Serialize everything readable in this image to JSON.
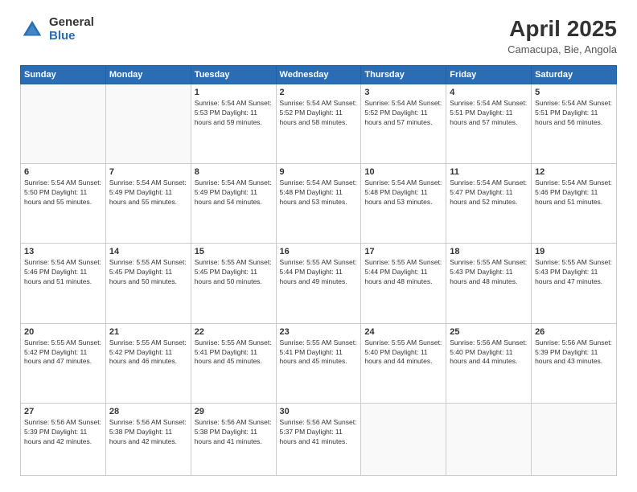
{
  "header": {
    "logo": {
      "general": "General",
      "blue": "Blue"
    },
    "title": "April 2025",
    "location": "Camacupa, Bie, Angola"
  },
  "calendar": {
    "days_of_week": [
      "Sunday",
      "Monday",
      "Tuesday",
      "Wednesday",
      "Thursday",
      "Friday",
      "Saturday"
    ],
    "weeks": [
      [
        {
          "day": "",
          "content": ""
        },
        {
          "day": "",
          "content": ""
        },
        {
          "day": "1",
          "content": "Sunrise: 5:54 AM\nSunset: 5:53 PM\nDaylight: 11 hours and 59 minutes."
        },
        {
          "day": "2",
          "content": "Sunrise: 5:54 AM\nSunset: 5:52 PM\nDaylight: 11 hours and 58 minutes."
        },
        {
          "day": "3",
          "content": "Sunrise: 5:54 AM\nSunset: 5:52 PM\nDaylight: 11 hours and 57 minutes."
        },
        {
          "day": "4",
          "content": "Sunrise: 5:54 AM\nSunset: 5:51 PM\nDaylight: 11 hours and 57 minutes."
        },
        {
          "day": "5",
          "content": "Sunrise: 5:54 AM\nSunset: 5:51 PM\nDaylight: 11 hours and 56 minutes."
        }
      ],
      [
        {
          "day": "6",
          "content": "Sunrise: 5:54 AM\nSunset: 5:50 PM\nDaylight: 11 hours and 55 minutes."
        },
        {
          "day": "7",
          "content": "Sunrise: 5:54 AM\nSunset: 5:49 PM\nDaylight: 11 hours and 55 minutes."
        },
        {
          "day": "8",
          "content": "Sunrise: 5:54 AM\nSunset: 5:49 PM\nDaylight: 11 hours and 54 minutes."
        },
        {
          "day": "9",
          "content": "Sunrise: 5:54 AM\nSunset: 5:48 PM\nDaylight: 11 hours and 53 minutes."
        },
        {
          "day": "10",
          "content": "Sunrise: 5:54 AM\nSunset: 5:48 PM\nDaylight: 11 hours and 53 minutes."
        },
        {
          "day": "11",
          "content": "Sunrise: 5:54 AM\nSunset: 5:47 PM\nDaylight: 11 hours and 52 minutes."
        },
        {
          "day": "12",
          "content": "Sunrise: 5:54 AM\nSunset: 5:46 PM\nDaylight: 11 hours and 51 minutes."
        }
      ],
      [
        {
          "day": "13",
          "content": "Sunrise: 5:54 AM\nSunset: 5:46 PM\nDaylight: 11 hours and 51 minutes."
        },
        {
          "day": "14",
          "content": "Sunrise: 5:55 AM\nSunset: 5:45 PM\nDaylight: 11 hours and 50 minutes."
        },
        {
          "day": "15",
          "content": "Sunrise: 5:55 AM\nSunset: 5:45 PM\nDaylight: 11 hours and 50 minutes."
        },
        {
          "day": "16",
          "content": "Sunrise: 5:55 AM\nSunset: 5:44 PM\nDaylight: 11 hours and 49 minutes."
        },
        {
          "day": "17",
          "content": "Sunrise: 5:55 AM\nSunset: 5:44 PM\nDaylight: 11 hours and 48 minutes."
        },
        {
          "day": "18",
          "content": "Sunrise: 5:55 AM\nSunset: 5:43 PM\nDaylight: 11 hours and 48 minutes."
        },
        {
          "day": "19",
          "content": "Sunrise: 5:55 AM\nSunset: 5:43 PM\nDaylight: 11 hours and 47 minutes."
        }
      ],
      [
        {
          "day": "20",
          "content": "Sunrise: 5:55 AM\nSunset: 5:42 PM\nDaylight: 11 hours and 47 minutes."
        },
        {
          "day": "21",
          "content": "Sunrise: 5:55 AM\nSunset: 5:42 PM\nDaylight: 11 hours and 46 minutes."
        },
        {
          "day": "22",
          "content": "Sunrise: 5:55 AM\nSunset: 5:41 PM\nDaylight: 11 hours and 45 minutes."
        },
        {
          "day": "23",
          "content": "Sunrise: 5:55 AM\nSunset: 5:41 PM\nDaylight: 11 hours and 45 minutes."
        },
        {
          "day": "24",
          "content": "Sunrise: 5:55 AM\nSunset: 5:40 PM\nDaylight: 11 hours and 44 minutes."
        },
        {
          "day": "25",
          "content": "Sunrise: 5:56 AM\nSunset: 5:40 PM\nDaylight: 11 hours and 44 minutes."
        },
        {
          "day": "26",
          "content": "Sunrise: 5:56 AM\nSunset: 5:39 PM\nDaylight: 11 hours and 43 minutes."
        }
      ],
      [
        {
          "day": "27",
          "content": "Sunrise: 5:56 AM\nSunset: 5:39 PM\nDaylight: 11 hours and 42 minutes."
        },
        {
          "day": "28",
          "content": "Sunrise: 5:56 AM\nSunset: 5:38 PM\nDaylight: 11 hours and 42 minutes."
        },
        {
          "day": "29",
          "content": "Sunrise: 5:56 AM\nSunset: 5:38 PM\nDaylight: 11 hours and 41 minutes."
        },
        {
          "day": "30",
          "content": "Sunrise: 5:56 AM\nSunset: 5:37 PM\nDaylight: 11 hours and 41 minutes."
        },
        {
          "day": "",
          "content": ""
        },
        {
          "day": "",
          "content": ""
        },
        {
          "day": "",
          "content": ""
        }
      ]
    ]
  }
}
